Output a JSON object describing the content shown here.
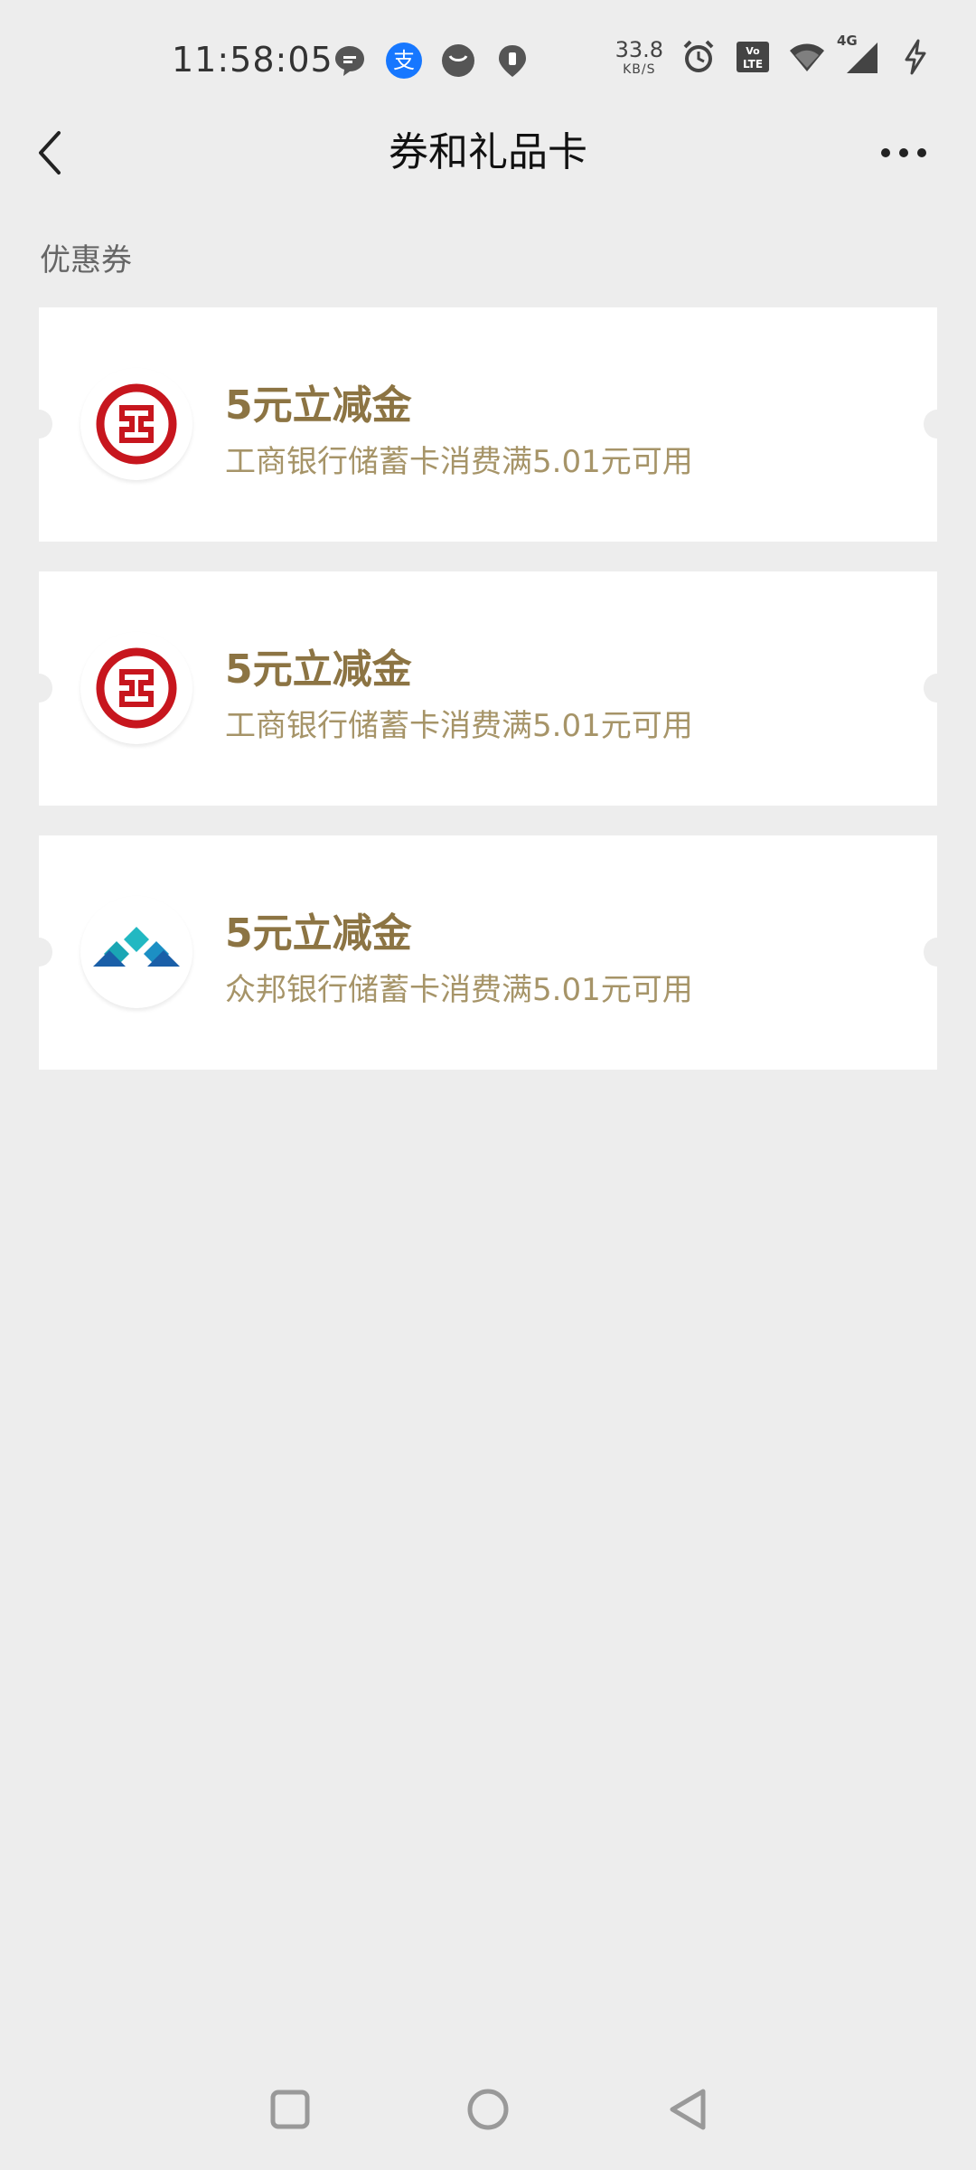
{
  "status_bar": {
    "time": "11:58:05",
    "net_speed_value": "33.8",
    "net_speed_unit": "KB/S",
    "network_type": "4G",
    "volte_label": "Vo LTE",
    "app_icons": [
      "message-icon",
      "alipay-icon",
      "taobao-icon",
      "location-icon"
    ],
    "right_icons": [
      "alarm-icon",
      "volte-icon",
      "wifi-icon",
      "signal-icon",
      "charging-icon"
    ]
  },
  "header": {
    "title": "券和礼品卡",
    "back_icon": "back-arrow-icon",
    "more_icon": "more-dots-icon"
  },
  "section": {
    "label": "优惠券"
  },
  "coupons": [
    {
      "title": "5元立减金",
      "desc": "工商银行储蓄卡消费满5.01元可用",
      "logo": "icbc-logo"
    },
    {
      "title": "5元立减金",
      "desc": "工商银行储蓄卡消费满5.01元可用",
      "logo": "icbc-logo"
    },
    {
      "title": "5元立减金",
      "desc": "众邦银行储蓄卡消费满5.01元可用",
      "logo": "zhongbang-logo"
    }
  ],
  "nav_bar": {
    "buttons": [
      "recent-apps-icon",
      "home-icon",
      "back-icon"
    ]
  },
  "colors": {
    "background": "#ededed",
    "card": "#ffffff",
    "coupon_title": "#8c7443",
    "coupon_desc": "#a69468",
    "icbc_red": "#c7161e"
  }
}
